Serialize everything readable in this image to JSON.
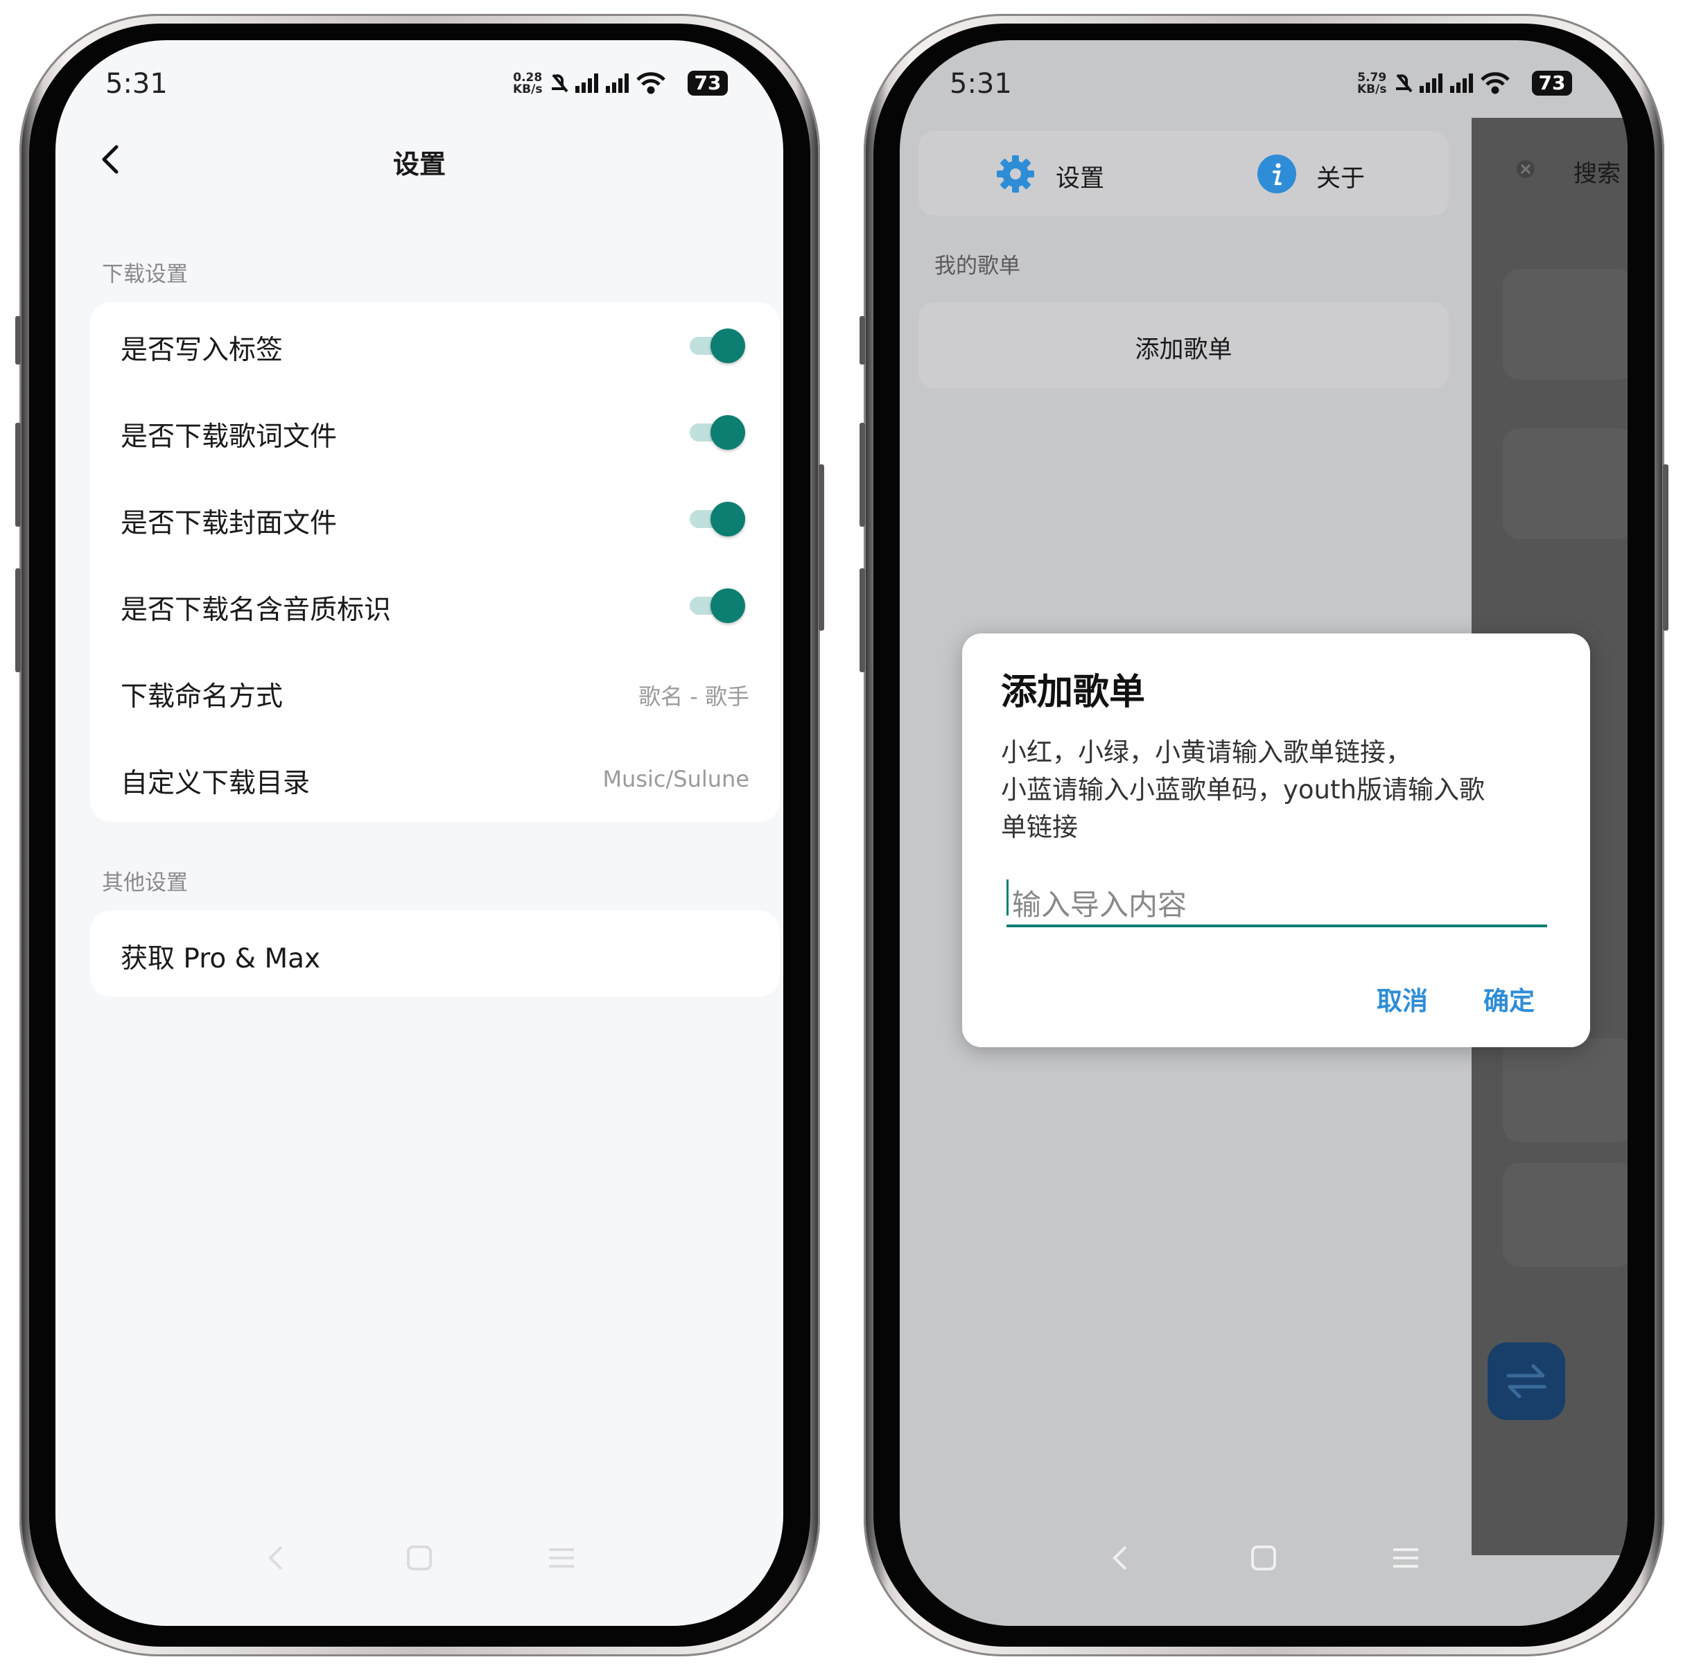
{
  "left_phone": {
    "status_bar": {
      "time": "5:31",
      "speed_value": "0.28",
      "speed_unit": "KB/s",
      "battery": "73"
    },
    "title": "设置",
    "sections": [
      {
        "label": "下载设置",
        "items": [
          {
            "label": "是否写入标签",
            "type": "toggle",
            "on": true
          },
          {
            "label": "是否下载歌词文件",
            "type": "toggle",
            "on": true
          },
          {
            "label": "是否下载封面文件",
            "type": "toggle",
            "on": true
          },
          {
            "label": "是否下载名含音质标识",
            "type": "toggle",
            "on": true
          },
          {
            "label": "下载命名方式",
            "type": "value",
            "value": "歌名 - 歌手"
          },
          {
            "label": "自定义下载目录",
            "type": "value",
            "value": "Music/Sulune"
          }
        ]
      },
      {
        "label": "其他设置",
        "items": [
          {
            "label": "获取 Pro & Max",
            "type": "link"
          }
        ]
      }
    ],
    "nav": [
      "back-icon",
      "home-icon",
      "menu-icon"
    ]
  },
  "right_phone": {
    "status_bar": {
      "time": "5:31",
      "speed_value": "5.79",
      "speed_unit": "KB/s",
      "battery": "73"
    },
    "drawer": {
      "tabs": [
        {
          "icon": "gear-icon",
          "label": "设置"
        },
        {
          "icon": "info-icon",
          "label": "关于"
        }
      ],
      "section_label": "我的歌单",
      "add_button": "添加歌单"
    },
    "background": {
      "search_label": "搜索"
    },
    "dialog": {
      "title": "添加歌单",
      "message_lines": [
        "小红，小绿，小黄请输入歌单链接，",
        "小蓝请输入小蓝歌单码，youth版请输入歌",
        "单链接"
      ],
      "input_placeholder": "输入导入内容",
      "cancel": "取消",
      "confirm": "确定"
    }
  },
  "colors": {
    "accent_teal": "#0d7f72",
    "dialog_button_blue": "#2e8dd6",
    "icon_blue": "#2e8dd6"
  }
}
